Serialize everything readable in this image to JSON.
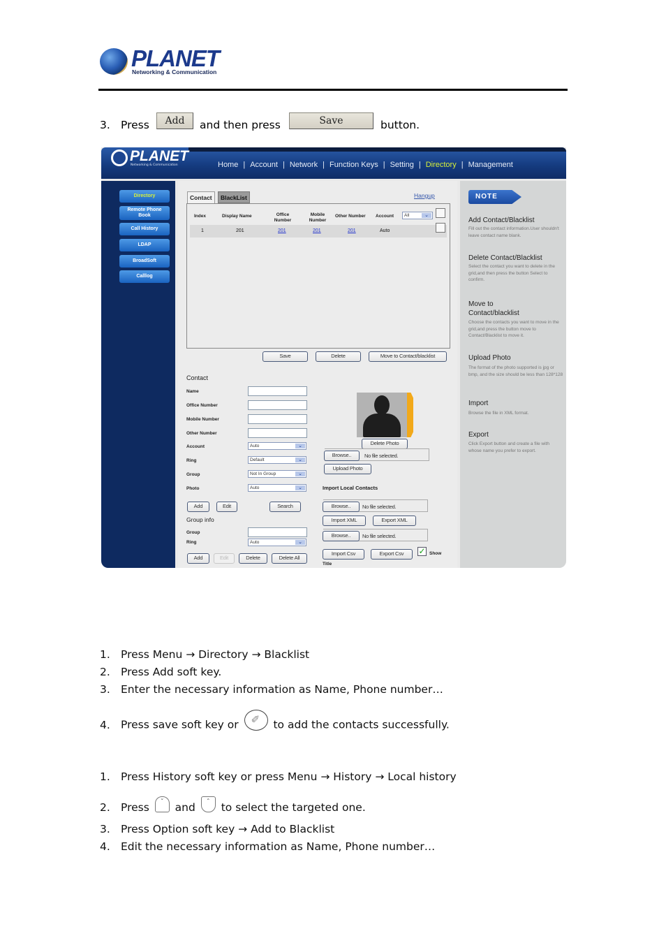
{
  "header": {
    "logo_word": "PLANET",
    "logo_sub": "Networking & Communication"
  },
  "step_intro": {
    "number": "3.",
    "press": "Press",
    "add_button": "Add",
    "and_then": "and then press",
    "save_button": "Save",
    "button_word": "button."
  },
  "screenshot": {
    "logo_word": "PLANET",
    "logo_sub": "Networking & Communication",
    "nav": [
      "Home",
      "Account",
      "Network",
      "Function Keys",
      "Setting",
      "Directory",
      "Management"
    ],
    "nav_active": "Directory",
    "sidebar": [
      "Directory",
      "Remote Phone Book",
      "Call History",
      "LDAP",
      "BroadSoft",
      "Calllog"
    ],
    "tabs": [
      "Contact",
      "BlackList"
    ],
    "hangup": "Hangup",
    "grid": {
      "headers": [
        "Index",
        "Display Name",
        "Office Number",
        "Mobile Number",
        "Other Number",
        "Account"
      ],
      "account_filter": "All",
      "rows": [
        {
          "index": "1",
          "display_name": "201",
          "office": "201",
          "mobile": "201",
          "other": "201",
          "account": "Auto"
        }
      ]
    },
    "grid_buttons": [
      "Save",
      "Delete",
      "Move to Contact/blacklist"
    ],
    "contact": {
      "title": "Contact",
      "fields": {
        "name": "Name",
        "office": "Office Number",
        "mobile": "Mobile Number",
        "other": "Other Number",
        "account": "Account",
        "ring": "Ring",
        "group": "Group",
        "photo": "Photo"
      },
      "values": {
        "account": "Auto",
        "ring": "Default",
        "group": "Not In Group",
        "photo": "Auto"
      },
      "buttons": [
        "Add",
        "Edit",
        "Search"
      ]
    },
    "group_info": {
      "title": "Group info",
      "group_label": "Group",
      "ring_label": "Ring",
      "ring_value": "Auto",
      "buttons": [
        "Add",
        "Edit",
        "Delete",
        "Delete All"
      ]
    },
    "photo": {
      "delete": "Delete Photo",
      "browse": "Browse..",
      "no_file": "No file selected.",
      "upload": "Upload Photo"
    },
    "import": {
      "title": "Import Local Contacts",
      "browse": "Browse..",
      "no_file": "No file selected.",
      "import_xml": "Import XML",
      "export_xml": "Export XML",
      "import_csv": "Import Csv",
      "export_csv": "Export Csv",
      "show_title_label_1": "Show",
      "show_title_label_2": "Title",
      "show_title_checked": true
    },
    "note": {
      "tag": "NOTE",
      "items": [
        {
          "title": "Add Contact/Blacklist",
          "text": "Fill out the contact information.User shouldn't leave contact name blank."
        },
        {
          "title": "Delete Contact/Blacklist",
          "text": "Select the contact you want to delete in the grid,and then press the button Select to confirm."
        },
        {
          "title": "Move to Contact/blacklist",
          "text": "Choose the contacts you want to move in the grid,and press the button move to Contact/Blacklist to move it."
        },
        {
          "title": "Upload Photo",
          "text": "The format of the photo supported is jpg or bmp, and the size should be less than 128*128"
        },
        {
          "title": "Import",
          "text": "Browse the file in XML format."
        },
        {
          "title": "Export",
          "text": "Click Export button and create a file with whose name you prefer to export."
        }
      ]
    }
  },
  "list_a": [
    {
      "num": "1.",
      "text": "Press Menu → Directory → Blacklist"
    },
    {
      "num": "2.",
      "text": "Press Add soft key."
    },
    {
      "num": "3.",
      "text": "Enter the necessary information as Name, Phone number…"
    },
    {
      "num": "4.",
      "before": "Press save soft key or",
      "after": "to add the contacts successfully."
    }
  ],
  "list_b": [
    {
      "num": "1.",
      "text": "Press History soft key or press Menu → History → Local history"
    },
    {
      "num": "2.",
      "before": "Press",
      "middle": "and",
      "after": "to select the targeted one."
    },
    {
      "num": "3.",
      "text": "Press Option soft key → Add to Blacklist"
    },
    {
      "num": "4.",
      "text": "Edit the necessary information as Name, Phone number…"
    }
  ],
  "icons": {
    "ok_key": "ok-key-icon",
    "down_key": "down-key-icon",
    "up_key": "up-key-icon"
  }
}
